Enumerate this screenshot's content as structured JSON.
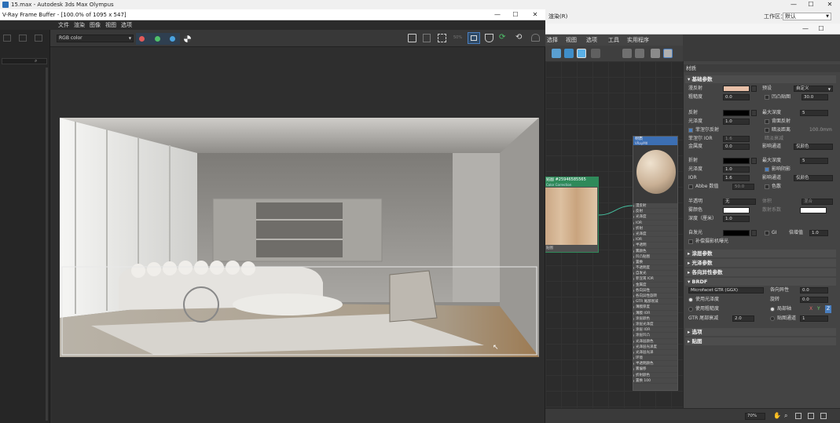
{
  "max_window": {
    "title": "15.max - Autodesk 3ds Max Olympus",
    "workspace_label": "工作区：",
    "workspace_value": "默认",
    "menu_partial": "渲染(R)"
  },
  "frame_buffer": {
    "title": "V-Ray Frame Buffer - [100.0% of 1095 x 547]",
    "menu": [
      "文件",
      "渲染",
      "图像",
      "视图",
      "选项"
    ],
    "channel_select": "RGB color",
    "colors": {
      "red": "#e05a5a",
      "green": "#4fc06a",
      "blue": "#4aa3e0",
      "accent": "#4a7fc0"
    }
  },
  "slate": {
    "menu": [
      "选择",
      "视图",
      "选项",
      "工具",
      "实用程序"
    ],
    "bitmap_node": {
      "title": "贴图 #25946585565",
      "subtitle": "Color Correction",
      "footer": "贴图"
    },
    "vray_node": {
      "title": "材质",
      "subtitle": "VRayMtl",
      "slots": [
        "漫反射",
        "反射",
        "光泽度",
        "IOR",
        "折射",
        "光泽度",
        "IOR",
        "半透明",
        "雾颜色",
        "凹凸贴图",
        "置换",
        "不透明度",
        "自发光",
        "菲涅耳 IOR",
        "金属度",
        "各向异性",
        "各向异性旋转",
        "GTR 尾部衰减",
        "薄膜厚度",
        "薄膜 IOR",
        "涂层颜色",
        "涂层光泽度",
        "涂层 IOR",
        "涂层凹凸",
        "光泽层颜色",
        "光泽层光泽度",
        "光泽层光泽",
        "环境",
        "半透明颜色",
        "雾偏移",
        "折射颜色",
        "置换 100"
      ]
    }
  },
  "params": {
    "header": "材质",
    "basic": {
      "title": "基础参数",
      "diffuse": "漫反射",
      "diffuse_color": "#e8c0a8",
      "preset_label": "预设",
      "preset_value": "自定义",
      "roughness": "粗糙度",
      "roughness_value": "0.0",
      "rounded_corners": "凹凸贴图",
      "rounded_value": "30.0",
      "reflect": "反射",
      "max_depth": "最大深度",
      "max_depth_value": "5",
      "gloss": "光泽度",
      "gloss_value": "1.0",
      "backside": "背面反射",
      "fresnel": "菲涅尔反射",
      "dim_dist": "暗淡距离",
      "dim_dist_value": "100.0mm",
      "fresnel_ior": "菲涅尔 IOR",
      "fresnel_ior_value": "1.6",
      "dim_falloff": "暗淡衰减",
      "metalness": "金属度",
      "metalness_value": "0.0",
      "affect_ch": "影响通道",
      "affect_ch_value": "仅颜色",
      "refract": "折射",
      "refract_depth": "最大深度",
      "refract_depth_value": "5",
      "r_gloss": "光泽度",
      "r_gloss_value": "1.0",
      "affect_shadows": "影响阴影",
      "ior": "IOR",
      "ior_value": "1.6",
      "r_affect": "影响通道",
      "r_affect_value": "仅颜色",
      "abbe": "Abbe 数值",
      "abbe_value": "50.0",
      "dispersion": "色散",
      "translucency": "半透明",
      "translucency_value": "无",
      "trans_mode": "体积",
      "trans_mode_value": "混合",
      "fog_color": "雾颜色",
      "scatter_coef": "散射系数",
      "fog_mult": "深度（厘米）",
      "fog_mult_value": "1.0",
      "self_illum": "自发光",
      "gi_label": "GI",
      "mult_label": "倍增值",
      "mult_value": "1.0",
      "compensate": "补偿摄影机曝光"
    },
    "rollouts": {
      "coat": "涂层参数",
      "sheen": "光泽参数",
      "aniso": "各向异性参数",
      "brdf": "BRDF",
      "options": "选项",
      "maps": "贴图"
    },
    "brdf": {
      "type": "Microfacet GTR (GGX)",
      "aniso_label": "各向异性",
      "aniso_value": "0.0",
      "use_gloss": "使用光泽度",
      "rotation": "旋转",
      "rotation_value": "0.0",
      "use_rough": "使用粗糙度",
      "local_axis": "局部轴",
      "axis_x": "X",
      "axis_y": "Y",
      "axis_z": "Z",
      "gtr_tail": "GTR 尾部衰减",
      "gtr_value": "2.0",
      "map_channel": "贴图通道",
      "map_channel_value": "1"
    }
  },
  "status": {
    "zoom": "70%"
  }
}
